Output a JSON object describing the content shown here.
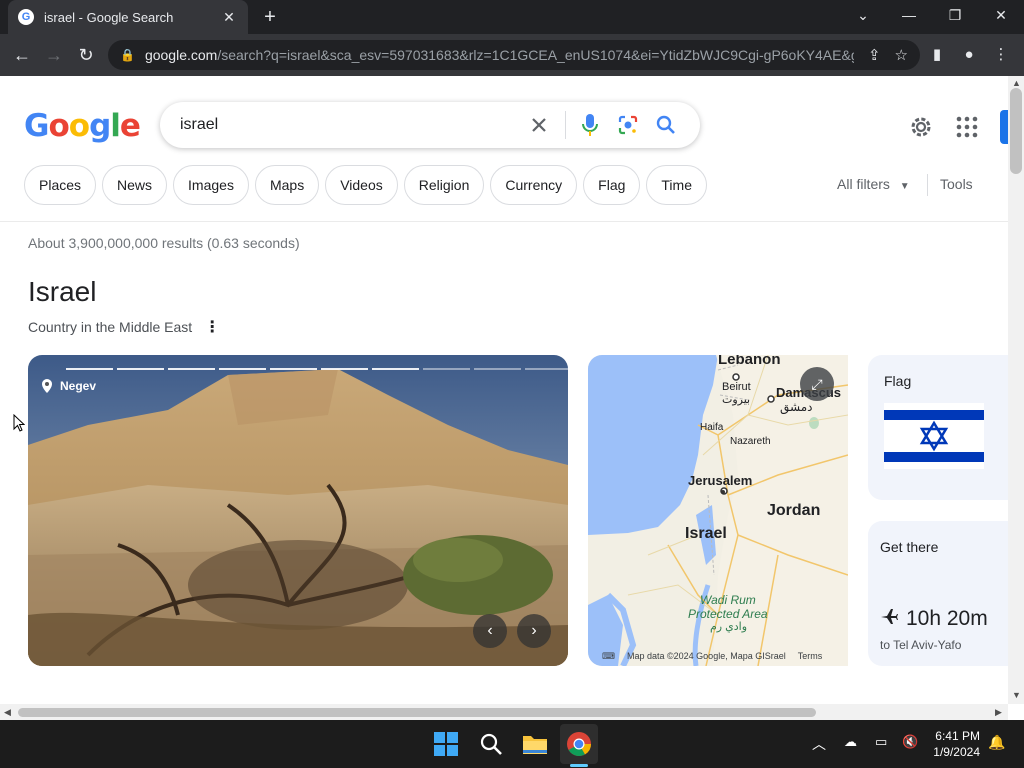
{
  "browser": {
    "tab_title": "israel - Google Search",
    "url_host": "google.com",
    "url_rest": "/search?q=israel&sca_esv=597031683&rlz=1C1GCEA_enUS1074&ei=YtidZbWJC9Cgi-gP6oKY4AE&g..."
  },
  "search": {
    "query": "israel",
    "chips": [
      "Places",
      "News",
      "Images",
      "Maps",
      "Videos",
      "Religion",
      "Currency",
      "Flag",
      "Time"
    ],
    "all_filters": "All filters",
    "tools": "Tools",
    "stats": "About 3,900,000,000 results (0.63 seconds)"
  },
  "knowledge_panel": {
    "title": "Israel",
    "subtitle": "Country in the Middle East",
    "photo_location": "Negev",
    "map": {
      "labels": {
        "lebanon": "Lebanon",
        "beirut": "Beirut",
        "beirut_ar": "بيروت",
        "damascus": "Damascus",
        "damascus_ar": "دمشق",
        "haifa": "Haifa",
        "nazareth": "Nazareth",
        "jerusalem": "Jerusalem",
        "jordan": "Jordan",
        "israel": "Israel",
        "wadi_rum": "Wadi Rum",
        "protected_area": "Protected Area",
        "wadi_rum_ar": "وادي رم"
      },
      "footer_data": "Map data ©2024 Google, Mapa GISrael",
      "footer_terms": "Terms"
    },
    "flag_card": {
      "label": "Flag"
    },
    "get_there": {
      "label": "Get there",
      "duration": "10h 20m",
      "destination": "to Tel Aviv-Yafo"
    }
  },
  "taskbar": {
    "time": "6:41 PM",
    "date": "1/9/2024"
  },
  "colors": {
    "google_blue": "#4285f4",
    "google_red": "#ea4335",
    "google_yellow": "#fbbc05",
    "google_green": "#34a853",
    "flag_blue": "#0038b8"
  }
}
